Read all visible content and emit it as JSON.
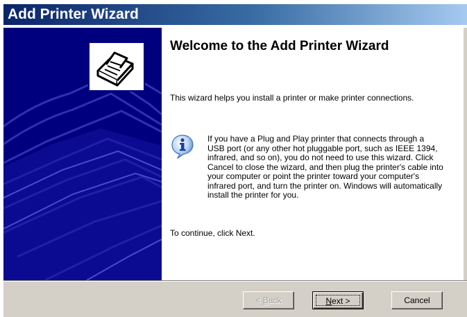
{
  "window": {
    "title": "Add Printer Wizard"
  },
  "content": {
    "heading": "Welcome to the Add Printer Wizard",
    "intro": "This wizard helps you install a printer or make printer connections.",
    "info": "If you have a Plug and Play printer that connects through a USB port (or any other hot pluggable port, such as IEEE 1394, infrared, and so on), you do not need to use this wizard. Click Cancel to close the wizard, and then plug the printer's cable into your computer or point the printer toward your computer's infrared port, and turn the printer on. Windows will automatically install the printer for you.",
    "continue": "To continue, click Next."
  },
  "buttons": {
    "back": {
      "prefix": "< ",
      "mnemonic": "B",
      "rest": "ack",
      "enabled": false
    },
    "next": {
      "mnemonic": "N",
      "rest": "ext >",
      "enabled": true
    },
    "cancel": {
      "label": "Cancel",
      "enabled": true
    }
  },
  "icons": {
    "wizard": "printer-icon",
    "info": "info-icon"
  },
  "colors": {
    "title_gradient_start": "#0a246a",
    "title_gradient_end": "#a6caf0",
    "watermark_panel": "#00007f",
    "button_face": "#d4d0c8"
  }
}
